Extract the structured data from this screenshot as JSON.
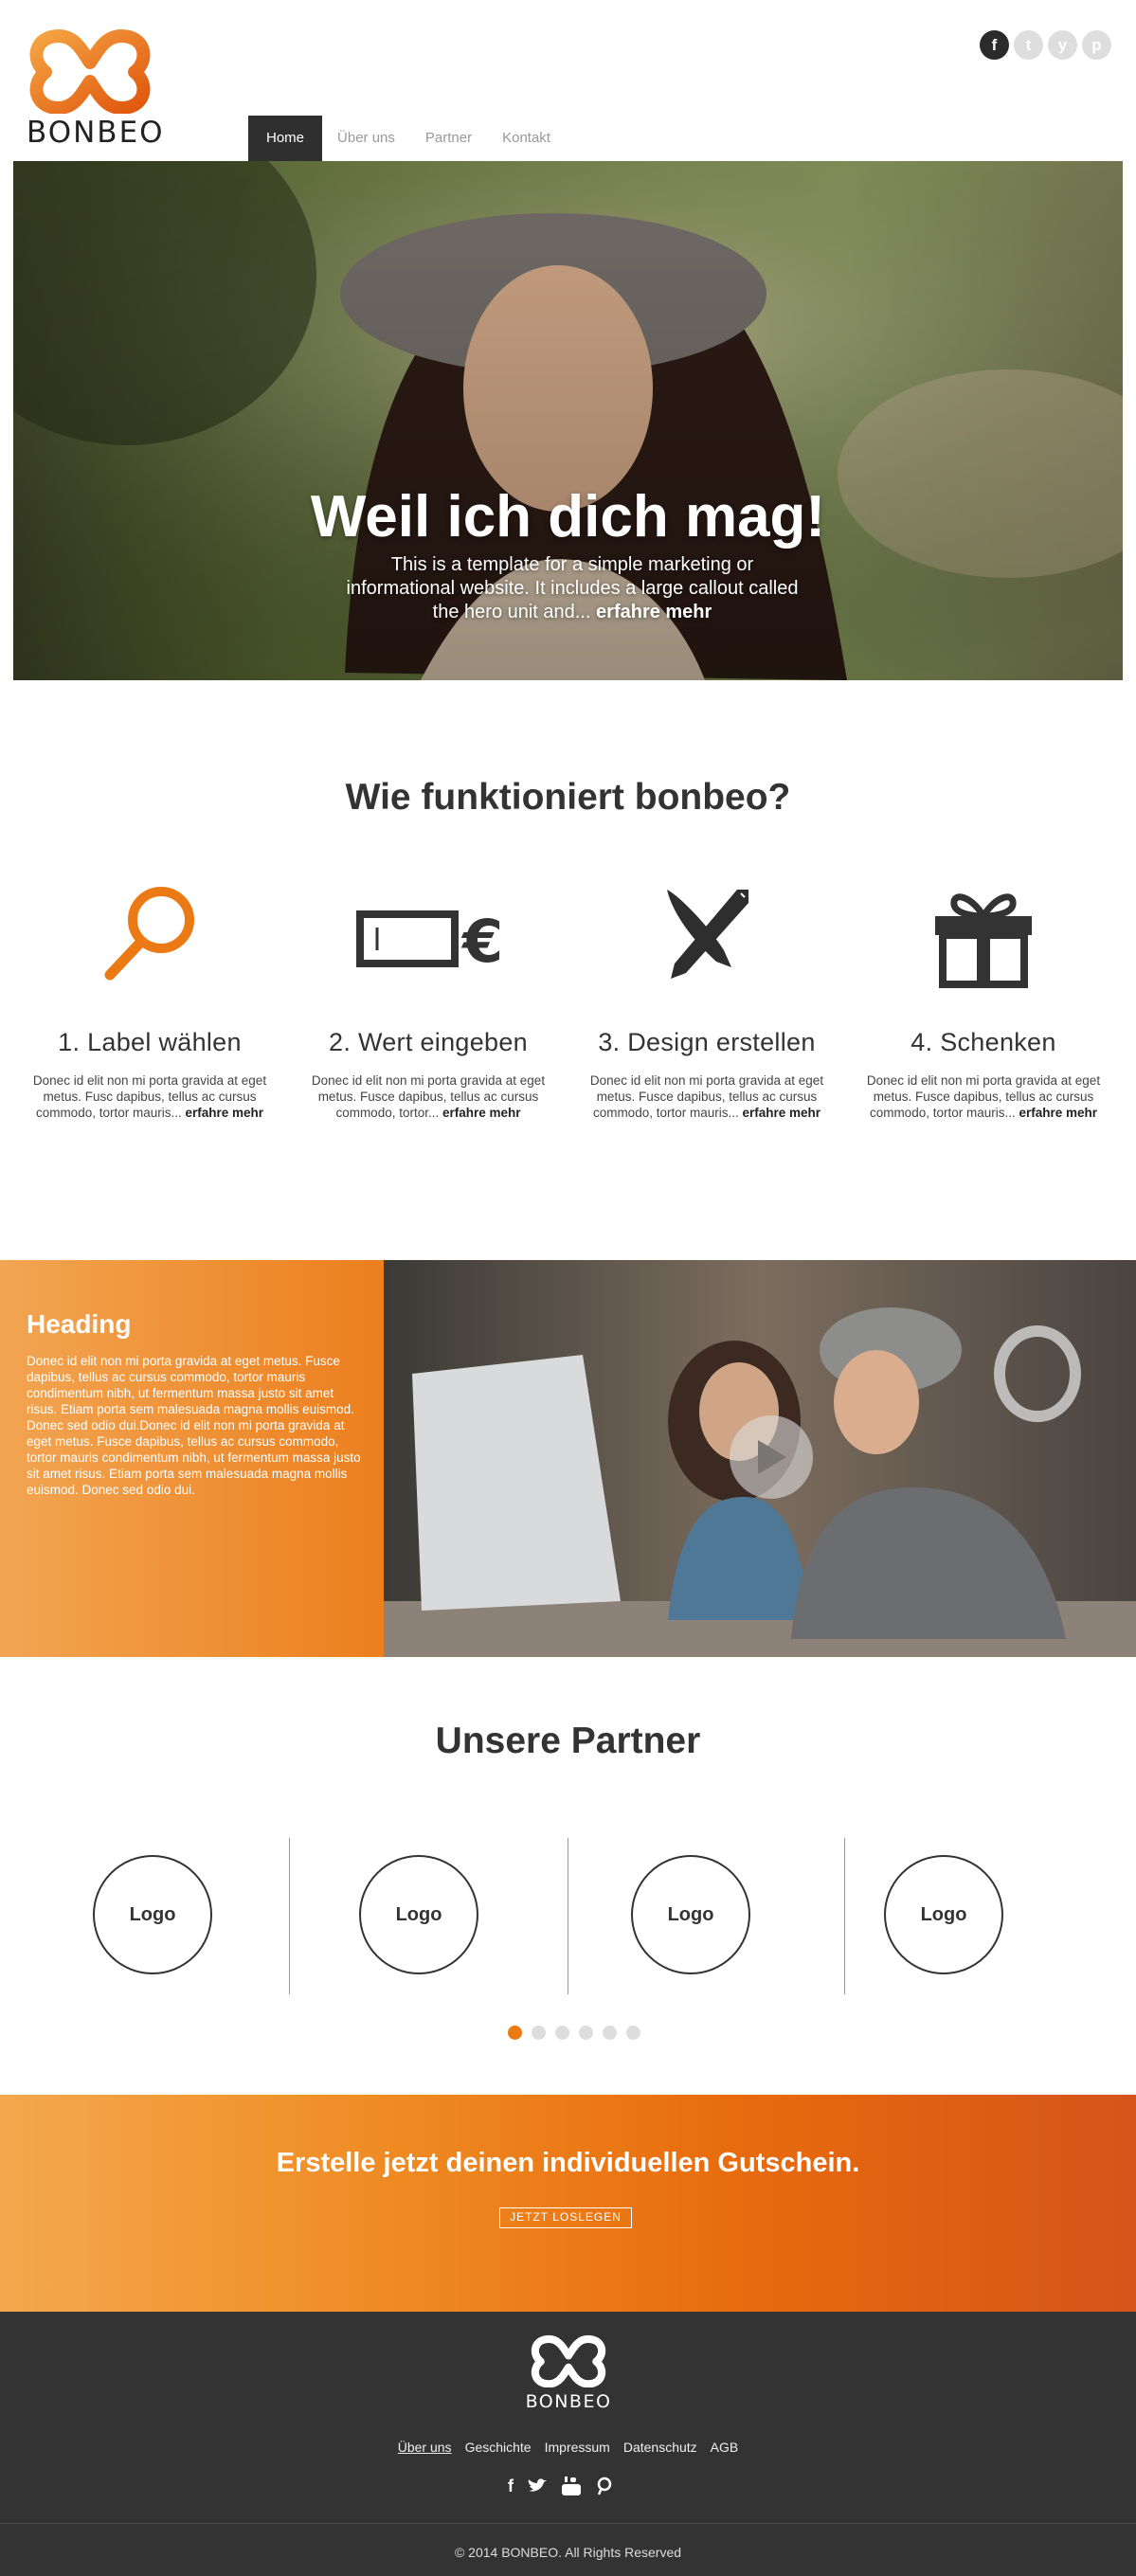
{
  "brand": {
    "name": "BONBEO",
    "accent": "#ec7a14",
    "dark": "#333333"
  },
  "social": [
    {
      "icon": "facebook-icon",
      "glyph": "f"
    },
    {
      "icon": "twitter-icon",
      "glyph": "t"
    },
    {
      "icon": "youtube-icon",
      "glyph": "y"
    },
    {
      "icon": "pinterest-icon",
      "glyph": "p"
    }
  ],
  "nav": {
    "items": [
      {
        "label": "Home",
        "active": true
      },
      {
        "label": "Über uns"
      },
      {
        "label": "Partner"
      },
      {
        "label": "Kontakt"
      }
    ]
  },
  "hero": {
    "title": "Weil ich dich mag!",
    "text": "This is a template for a simple marketing or informational website. It includes a large callout called the hero unit and...",
    "link": "erfahre mehr"
  },
  "how": {
    "title": "Wie funktioniert bonbeo?",
    "steps": [
      {
        "icon": "magnifier-icon",
        "title": "1. Label wählen",
        "text": "Donec id elit non mi porta gravida at eget metus. Fusc dapibus, tellus ac cursus commodo, tortor mauris...",
        "link": "erfahre mehr"
      },
      {
        "icon": "value-euro-icon",
        "title": "2. Wert eingeben",
        "text": "Donec id elit non mi porta gravida at eget metus. Fusce dapibus, tellus ac cursus commodo, tortor...",
        "link": "erfahre mehr"
      },
      {
        "icon": "brush-pen-icon",
        "title": "3. Design erstellen",
        "text": "Donec id elit non mi porta gravida at eget metus. Fusce dapibus, tellus ac cursus commodo, tortor mauris...",
        "link": "erfahre mehr"
      },
      {
        "icon": "gift-icon",
        "title": "4. Schenken",
        "text": "Donec id elit non mi porta gravida at eget metus. Fusce dapibus, tellus ac cursus commodo, tortor mauris...",
        "link": "erfahre mehr"
      }
    ]
  },
  "feature": {
    "heading": "Heading",
    "text": "Donec id elit non mi porta gravida at eget metus. Fusce dapibus, tellus ac cursus commodo, tortor mauris condimentum nibh, ut fermentum massa justo sit amet risus. Etiam porta sem malesuada magna mollis euismod. Donec sed odio dui.Donec id elit non mi porta gravida at eget metus. Fusce dapibus, tellus ac cursus commodo, tortor mauris condimentum nibh, ut fermentum massa justo sit amet risus. Etiam porta sem malesuada magna mollis euismod. Donec sed odio dui."
  },
  "partners": {
    "title": "Unsere Partner",
    "logos": [
      "Logo",
      "Logo",
      "Logo",
      "Logo"
    ],
    "dots": 6,
    "active_dot": 0
  },
  "cta": {
    "title": "Erstelle jetzt deinen individuellen Gutschein.",
    "button": "JETZT LOSLEGEN"
  },
  "footer": {
    "brand": "BONBEO",
    "links": [
      {
        "label": "Über uns",
        "active": true
      },
      {
        "label": "Geschichte"
      },
      {
        "label": "Impressum"
      },
      {
        "label": "Datenschutz"
      },
      {
        "label": "AGB"
      }
    ],
    "social": [
      "facebook-icon",
      "twitter-icon",
      "youtube-icon",
      "pinterest-icon"
    ],
    "copyright": "© 2014 BONBEO. All Rights Reserved"
  }
}
